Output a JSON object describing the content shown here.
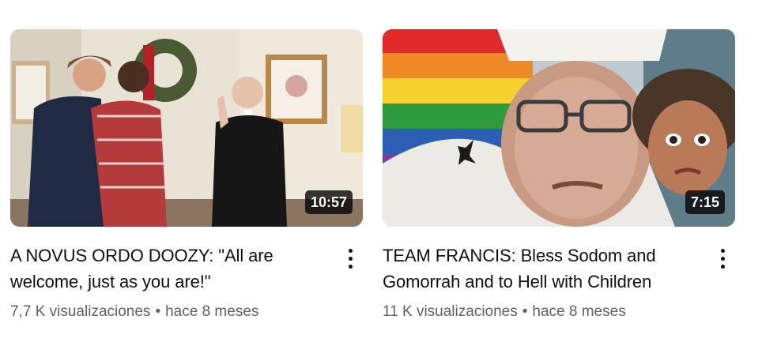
{
  "videos": [
    {
      "title": "A NOVUS ORDO DOOZY: \"All are welcome, just as you are!\"",
      "duration": "10:57",
      "views": "7,7 K visualizaciones",
      "separator": "•",
      "age": "hace 8 meses",
      "menu_icon": "more-vert-icon"
    },
    {
      "title": "TEAM FRANCIS: Bless Sodom and Gomorrah and to Hell with Children",
      "duration": "7:15",
      "views": "11 K visualizaciones",
      "separator": "•",
      "age": "hace 8 meses",
      "menu_icon": "more-vert-icon"
    }
  ],
  "colors": {
    "title": "#0f0f0f",
    "secondary": "#606060",
    "duration_bg": "#000000"
  }
}
